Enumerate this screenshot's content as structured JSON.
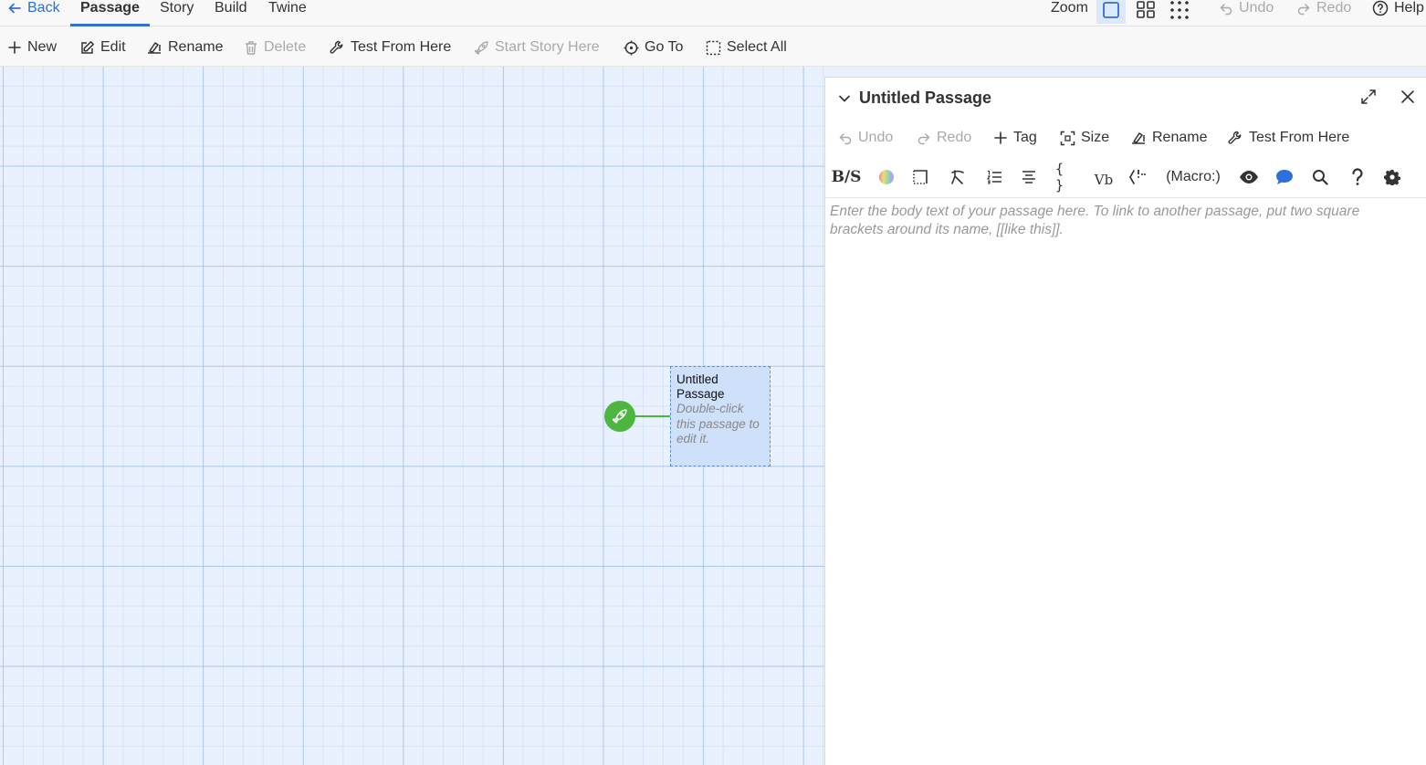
{
  "topnav": {
    "back_label": "Back",
    "tabs": [
      "Passage",
      "Story",
      "Build",
      "Twine"
    ],
    "zoom_label": "Zoom",
    "undo_label": "Undo",
    "redo_label": "Redo",
    "help_label": "Help"
  },
  "toolbar": {
    "new_label": "New",
    "edit_label": "Edit",
    "rename_label": "Rename",
    "delete_label": "Delete",
    "test_label": "Test From Here",
    "start_label": "Start Story Here",
    "goto_label": "Go To",
    "selectall_label": "Select All"
  },
  "canvas": {
    "passage_title": "Untitled Passage",
    "passage_excerpt": "Double-click this passage to edit it."
  },
  "dialog": {
    "title": "Untitled Passage",
    "undo_label": "Undo",
    "redo_label": "Redo",
    "tag_label": "Tag",
    "size_label": "Size",
    "rename_label": "Rename",
    "test_label": "Test From Here",
    "macro_button_text": "(Macro:)",
    "vb_text": "Vb",
    "bs_text": "B/S",
    "braces_text": "{ }",
    "body_placeholder": "Enter the body text of your passage here. To link to another passage, put two square brackets around its name, [[like this]]."
  },
  "colors": {
    "accent": "#2f6fdb",
    "start_green": "#4cb640",
    "canvas_bg": "#e8f1fd",
    "passage_bg": "#cfe0fa"
  }
}
